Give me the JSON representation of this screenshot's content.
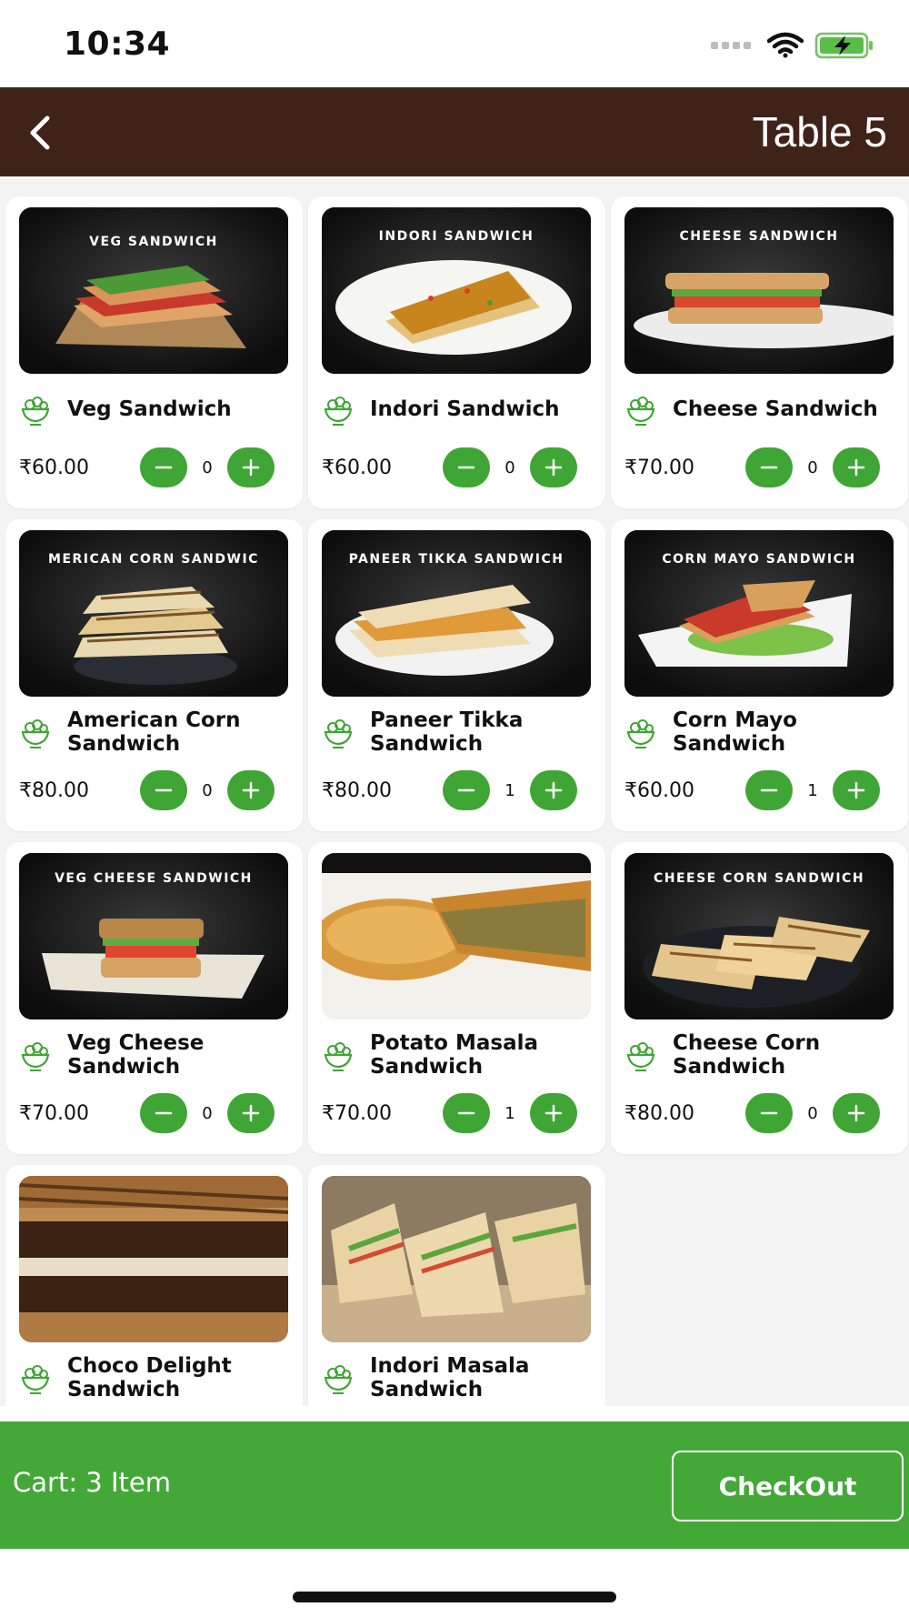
{
  "status_bar": {
    "time": "10:34"
  },
  "header": {
    "title": "Table 5",
    "back_icon": "chevron-left-icon"
  },
  "currency": "₹",
  "items": [
    {
      "name": "Veg Sandwich",
      "price": "₹60.00",
      "qty": "0",
      "image_caption": "VEG SANDWICH",
      "image": "sandwich-stack-photo"
    },
    {
      "name": "Indori Sandwich",
      "price": "₹60.00",
      "qty": "0",
      "image_caption": "INDORI SANDWICH",
      "image": "sev-sandwich-plate-photo"
    },
    {
      "name": "Cheese Sandwich",
      "price": "₹70.00",
      "qty": "0",
      "image_caption": "CHEESE SANDWICH",
      "image": "cheese-sandwich-photo"
    },
    {
      "name": "American Corn Sandwich",
      "price": "₹80.00",
      "qty": "0",
      "image_caption": "MERICAN CORN SANDWIC",
      "image": "grilled-sandwich-photo"
    },
    {
      "name": "Paneer Tikka Sandwich",
      "price": "₹80.00",
      "qty": "1",
      "image_caption": "PANEER TIKKA SANDWICH",
      "image": "paneer-sandwich-photo"
    },
    {
      "name": "Corn Mayo Sandwich",
      "price": "₹60.00",
      "qty": "1",
      "image_caption": "CORN MAYO SANDWICH",
      "image": "corn-mayo-sandwich-photo"
    },
    {
      "name": "Veg Cheese Sandwich",
      "price": "₹70.00",
      "qty": "0",
      "image_caption": "VEG CHEESE SANDWICH",
      "image": "veg-cheese-sandwich-photo"
    },
    {
      "name": "Potato Masala Sandwich",
      "price": "₹70.00",
      "qty": "1",
      "image_caption": "",
      "image": "potato-masala-sandwich-photo"
    },
    {
      "name": "Cheese Corn Sandwich",
      "price": "₹80.00",
      "qty": "0",
      "image_caption": "CHEESE CORN SANDWICH",
      "image": "cheese-corn-sandwich-photo"
    },
    {
      "name": "Choco Delight Sandwich",
      "price": "",
      "qty": "",
      "image_caption": "",
      "image": "choco-sandwich-photo"
    },
    {
      "name": "Indori Masala Sandwich",
      "price": "",
      "qty": "",
      "image_caption": "",
      "image": "indori-masala-sandwich-photo"
    }
  ],
  "cart": {
    "label": "Cart: 3 Item",
    "checkout_label": "CheckOut"
  },
  "colors": {
    "header_bg": "#3f2218",
    "accent_green": "#44a838",
    "button_green": "#3fa534"
  }
}
